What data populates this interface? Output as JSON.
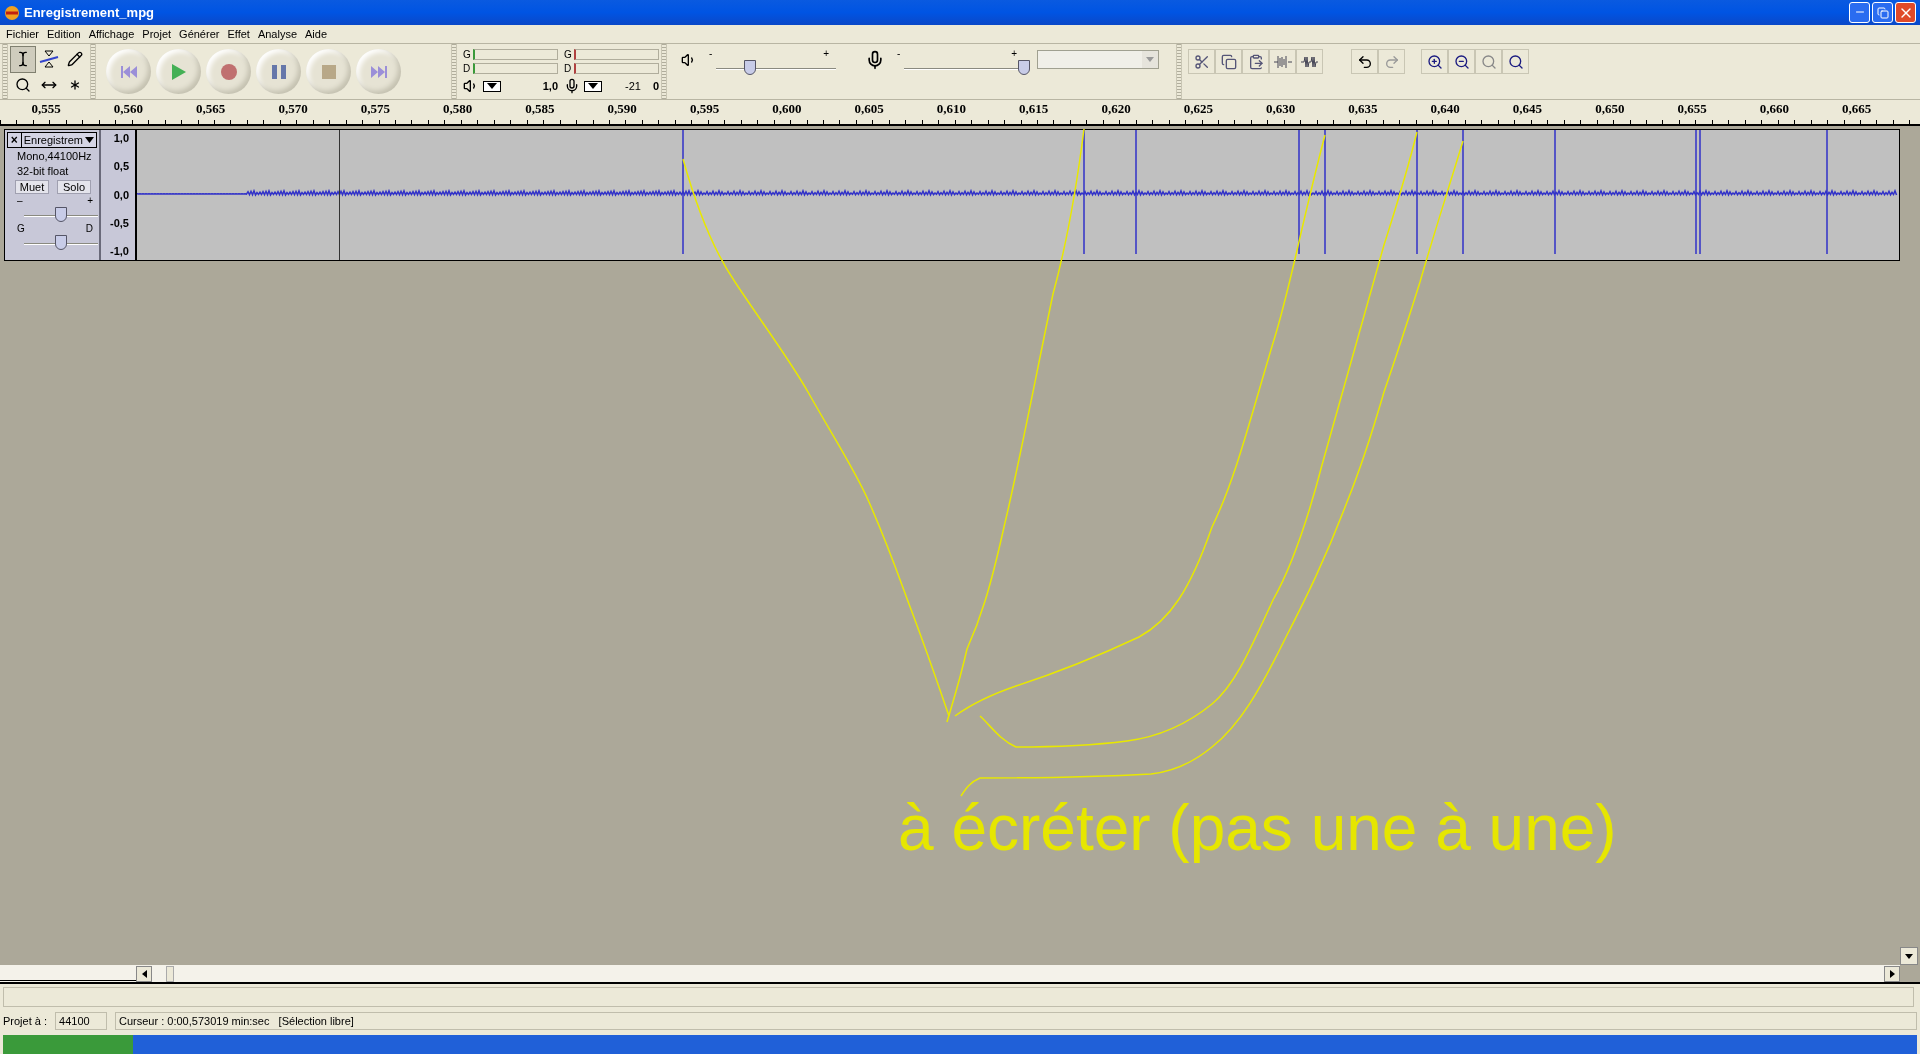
{
  "window": {
    "title": "Enregistrement_mpg"
  },
  "menu": [
    {
      "label": "Fichier"
    },
    {
      "label": "Edition"
    },
    {
      "label": "Affichage"
    },
    {
      "label": "Projet"
    },
    {
      "label": "Générer"
    },
    {
      "label": "Effet"
    },
    {
      "label": "Analyse"
    },
    {
      "label": "Aide"
    }
  ],
  "tools": [
    {
      "kind": "select",
      "selected": true
    },
    {
      "kind": "envelope",
      "selected": false
    },
    {
      "kind": "draw",
      "selected": false
    },
    {
      "kind": "zoom",
      "selected": false
    },
    {
      "kind": "timeshift",
      "selected": false
    },
    {
      "kind": "multi",
      "selected": false
    }
  ],
  "transport": [
    {
      "kind": "home"
    },
    {
      "kind": "play"
    },
    {
      "kind": "record"
    },
    {
      "kind": "pause"
    },
    {
      "kind": "stop"
    },
    {
      "kind": "end"
    }
  ],
  "meters": {
    "play_channel_labels": [
      "G",
      "D"
    ],
    "record_channel_labels": [
      "G",
      "D"
    ],
    "play_reading": "1,0",
    "record_readings": [
      "-21",
      "0"
    ]
  },
  "mixer": {
    "output": {
      "minus": "-",
      "plus": "+",
      "level": 0.28
    },
    "input": {
      "minus": "-",
      "plus": "+",
      "level": 1.0
    }
  },
  "ruler": {
    "ticks": [
      "0,555",
      "0,560",
      "0,565",
      "0,570",
      "0,575",
      "0,580",
      "0,585",
      "0,590",
      "0,595",
      "0,600",
      "0,605",
      "0,610",
      "0,615",
      "0,620",
      "0,625",
      "0,630",
      "0,635",
      "0,640",
      "0,645",
      "0,650",
      "0,655",
      "0,660",
      "0,665"
    ]
  },
  "track": {
    "close": "×",
    "name": "Enregistrem",
    "info": [
      "Mono,44100Hz",
      "32-bit float"
    ],
    "buttons": [
      "Muet",
      "Solo"
    ],
    "gain": {
      "minus": "–",
      "plus": "+",
      "level": 0.5
    },
    "pan": {
      "left": "G",
      "right": "D",
      "level": 0.5
    },
    "scale": [
      "1,0",
      "0,5",
      "0,0",
      "-0,5",
      "-1,0"
    ]
  },
  "annotation": {
    "text": "à écréter (pas une à une)"
  },
  "status": {
    "rate_label": "Projet à :",
    "rate": "44100",
    "cursor": "Curseur : 0:00,573019 min:sec   [Sélection libre]"
  }
}
